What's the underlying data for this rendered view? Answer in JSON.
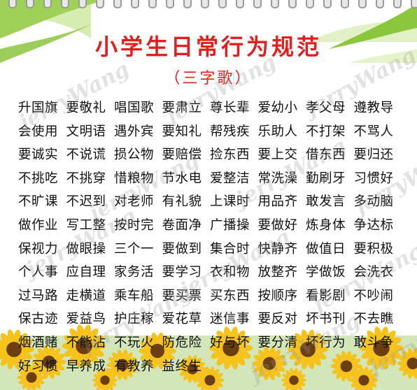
{
  "poster": {
    "title": "小学生日常行为规范",
    "subtitle": "（三字歌）",
    "watermark": "jerryWang",
    "colors": {
      "title": "#e0201e",
      "accent_green": "#8cc63f",
      "sunflower": "#f5c31c"
    }
  },
  "rows": [
    [
      "升国旗",
      "要敬礼",
      "唱国歌",
      "要肃立",
      "尊长辈",
      "爱幼小",
      "孝父母",
      "遵教导"
    ],
    [
      "会使用",
      "文明语",
      "遇外宾",
      "要知礼",
      "帮残疾",
      "乐助人",
      "不打架",
      "不骂人"
    ],
    [
      "要诚实",
      "不说谎",
      "损公物",
      "要赔偿",
      "捡东西",
      "要上交",
      "借东西",
      "要归还"
    ],
    [
      "不挑吃",
      "不挑穿",
      "惜粮物",
      "节水电",
      "爱整洁",
      "常洗澡",
      "勤刷牙",
      "习惯好"
    ],
    [
      "不旷课",
      "不迟到",
      "对老师",
      "有礼貌",
      "上课时",
      "用品齐",
      "敢发言",
      "多动脑"
    ],
    [
      "做作业",
      "写工整",
      "按时完",
      "卷面净",
      "广播操",
      "要做好",
      "炼身体",
      "争达标"
    ],
    [
      "保视力",
      "做眼操",
      "三个一",
      "要做到",
      "集合时",
      "快静齐",
      "做值日",
      "要积极"
    ],
    [
      "个人事",
      "应自理",
      "家务活",
      "要学习",
      "衣和物",
      "放整齐",
      "学做饭",
      "会洗衣"
    ],
    [
      "过马路",
      "走横道",
      "乘车船",
      "要买票",
      "买东西",
      "按顺序",
      "看影剧",
      "不吵闹"
    ],
    [
      "保古迹",
      "爱益鸟",
      "护庄稼",
      "爱花草",
      "迷信事",
      "要反对",
      "坏书刊",
      "不去瞧"
    ],
    [
      "烟酒赌",
      "不能沾",
      "不玩火",
      "防危险",
      "好与坏",
      "要分清",
      "坏行为",
      "敢斗争"
    ],
    [
      "好习惯",
      "早养成",
      "有教养",
      "益终生",
      "",
      "",
      "",
      ""
    ]
  ]
}
